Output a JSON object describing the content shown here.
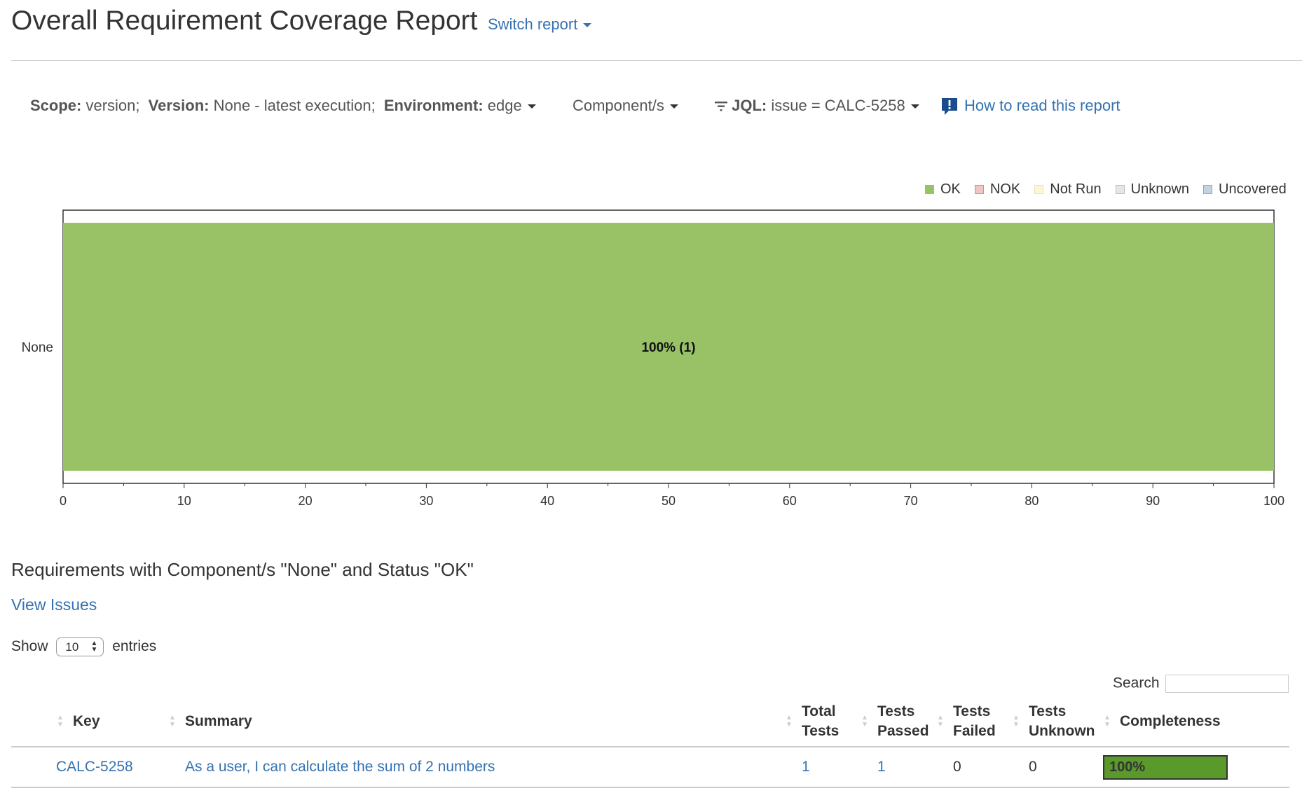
{
  "header": {
    "title": "Overall Requirement Coverage Report",
    "switch_report": "Switch report"
  },
  "filters": {
    "scope_label": "Scope:",
    "scope_value": "version;",
    "version_label": "Version:",
    "version_value": "None - latest execution;",
    "environment_label": "Environment:",
    "environment_value": "edge",
    "components": "Component/s",
    "jql_label": "JQL:",
    "jql_value": "issue = CALC-5258",
    "help_link": "How to read this report"
  },
  "legend": [
    {
      "label": "OK",
      "color": "#99c166",
      "border": "#99c166"
    },
    {
      "label": "NOK",
      "color": "#f2c4c4",
      "border": "#d98a8a"
    },
    {
      "label": "Not Run",
      "color": "#fbf6d8",
      "border": "#ece3b0"
    },
    {
      "label": "Unknown",
      "color": "#e6e6e6",
      "border": "#bdbdbd"
    },
    {
      "label": "Uncovered",
      "color": "#c4d3e2",
      "border": "#8fa8c4"
    }
  ],
  "chart_data": {
    "type": "bar",
    "orientation": "horizontal",
    "stacked": true,
    "categories": [
      "None"
    ],
    "series": [
      {
        "name": "OK",
        "values": [
          100
        ],
        "count": [
          1
        ],
        "color": "#99c166"
      }
    ],
    "data_labels": [
      "100% (1)"
    ],
    "xlim": [
      0,
      100
    ],
    "xticks": [
      0,
      10,
      20,
      30,
      40,
      50,
      60,
      70,
      80,
      90,
      100
    ],
    "grid": false,
    "legend": "top-right"
  },
  "list": {
    "title": "Requirements with Component/s \"None\" and Status \"OK\"",
    "view_issues": "View Issues",
    "show_label": "Show",
    "show_value": "10",
    "entries_label": "entries",
    "search_label": "Search",
    "columns": [
      "Key",
      "Summary",
      "Total Tests",
      "Tests Passed",
      "Tests Failed",
      "Tests Unknown",
      "Completeness"
    ],
    "rows": [
      {
        "key": "CALC-5258",
        "summary": "As a user, I can calculate the sum of 2 numbers",
        "total": "1",
        "passed": "1",
        "failed": "0",
        "unknown": "0",
        "completeness": "100%"
      }
    ]
  }
}
